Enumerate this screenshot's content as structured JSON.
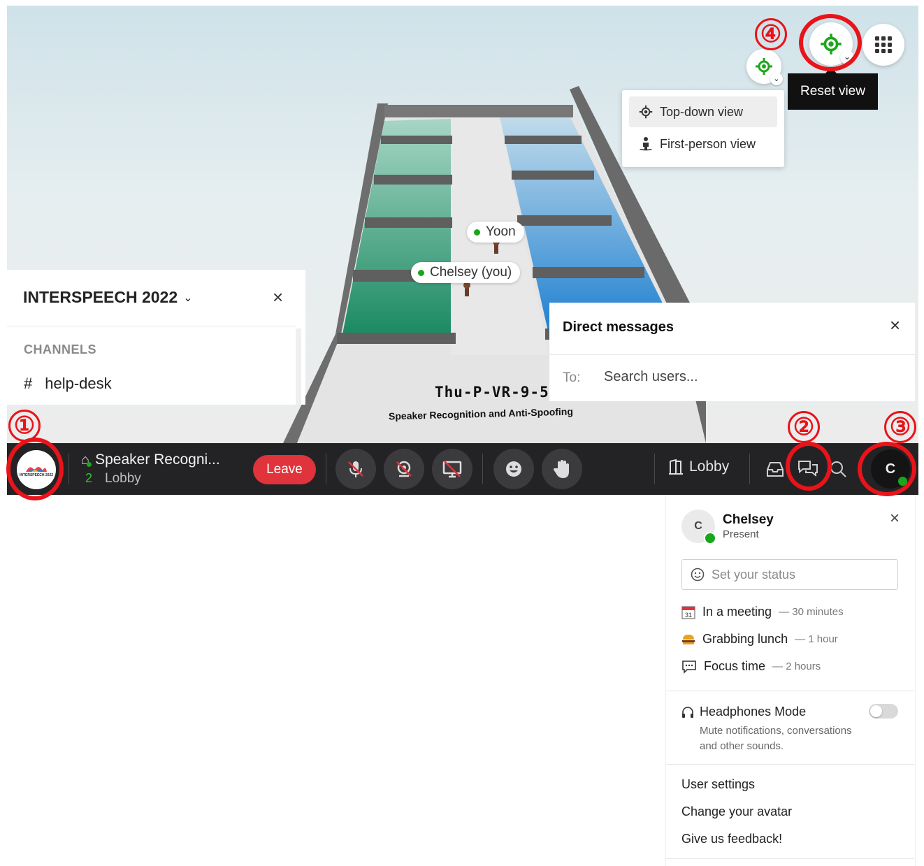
{
  "annotations": {
    "one": "①",
    "two": "②",
    "three": "③",
    "four": "④"
  },
  "scene": {
    "room_title": "Thu-P-VR-9-5",
    "room_subtitle": "Speaker Recognition and Anti-Spoofing",
    "avatars": [
      {
        "name": "Yoon"
      },
      {
        "name": "Chelsey (you)"
      }
    ]
  },
  "view_controls": {
    "tooltip": "Reset view",
    "menu": [
      {
        "label": "Top-down view",
        "icon": "crosshair-icon"
      },
      {
        "label": "First-person view",
        "icon": "person-icon"
      }
    ]
  },
  "sidebar": {
    "workspace": "INTERSPEECH 2022",
    "section": "CHANNELS",
    "channels": [
      {
        "hash": "#",
        "name": "help-desk"
      }
    ]
  },
  "direct_messages": {
    "title": "Direct messages",
    "to_label": "To:",
    "placeholder": "Search users..."
  },
  "toolbar": {
    "logo_text": "INTERSPEECH 2022",
    "room_name": "Speaker Recogni...",
    "count": "2",
    "location": "Lobby",
    "leave": "Leave",
    "lobby_button": "Lobby",
    "avatar_initial": "C"
  },
  "profile": {
    "initial": "C",
    "name": "Chelsey",
    "presence": "Present",
    "status_placeholder": "Set your status",
    "presets": [
      {
        "label": "In a meeting",
        "duration": "— 30 minutes",
        "icon": "calendar-icon"
      },
      {
        "label": "Grabbing lunch",
        "duration": "— 1 hour",
        "icon": "burger-icon"
      },
      {
        "label": "Focus time",
        "duration": "— 2 hours",
        "icon": "speech-bubble-icon"
      }
    ],
    "headphones_title": "Headphones Mode",
    "headphones_desc_1": "Mute notifications, conversations",
    "headphones_desc_2": "and other sounds.",
    "headphones_on": false,
    "links": [
      "User settings",
      "Change your avatar",
      "Give us feedback!"
    ]
  },
  "colors": {
    "accent_red": "#e8141a",
    "leave_red": "#e0333b",
    "online_green": "#1aa61a",
    "toolbar_bg": "#232325"
  }
}
